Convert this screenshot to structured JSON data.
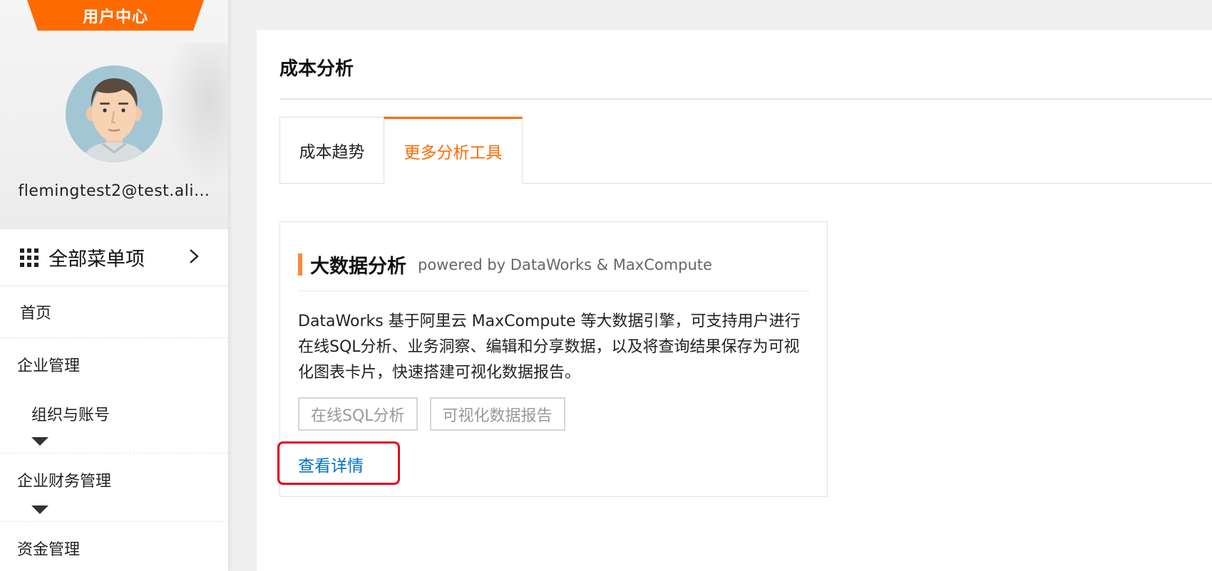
{
  "sidebar": {
    "header_tab": "用户中心",
    "email": "flemingtest2@test.ali…",
    "all_menu_label": "全部菜单项",
    "home": "首页",
    "groups": [
      {
        "title": "企业管理",
        "sub": "组织与账号"
      },
      {
        "title": "企业财务管理"
      },
      {
        "title": "资金管理"
      }
    ]
  },
  "main": {
    "page_title": "成本分析",
    "tabs": [
      {
        "label": "成本趋势",
        "active": false
      },
      {
        "label": "更多分析工具",
        "active": true
      }
    ],
    "card": {
      "title": "大数据分析",
      "subtitle": "powered by DataWorks & MaxCompute",
      "description": "DataWorks 基于阿里云 MaxCompute 等大数据引擎，可支持用户进行在线SQL分析、业务洞察、编辑和分享数据，以及将查询结果保存为可视化图表卡片，快速搭建可视化数据报告。",
      "tags": [
        "在线SQL分析",
        "可视化数据报告"
      ],
      "link": "查看详情"
    }
  },
  "colors": {
    "accent": "#ff6a00",
    "link": "#0070cc",
    "highlight": "#e4001b"
  },
  "icons": {
    "all_menu": "grid-icon",
    "expand_menu": "chevron-right-icon",
    "collapse_toggle": "caret-down-icon"
  }
}
